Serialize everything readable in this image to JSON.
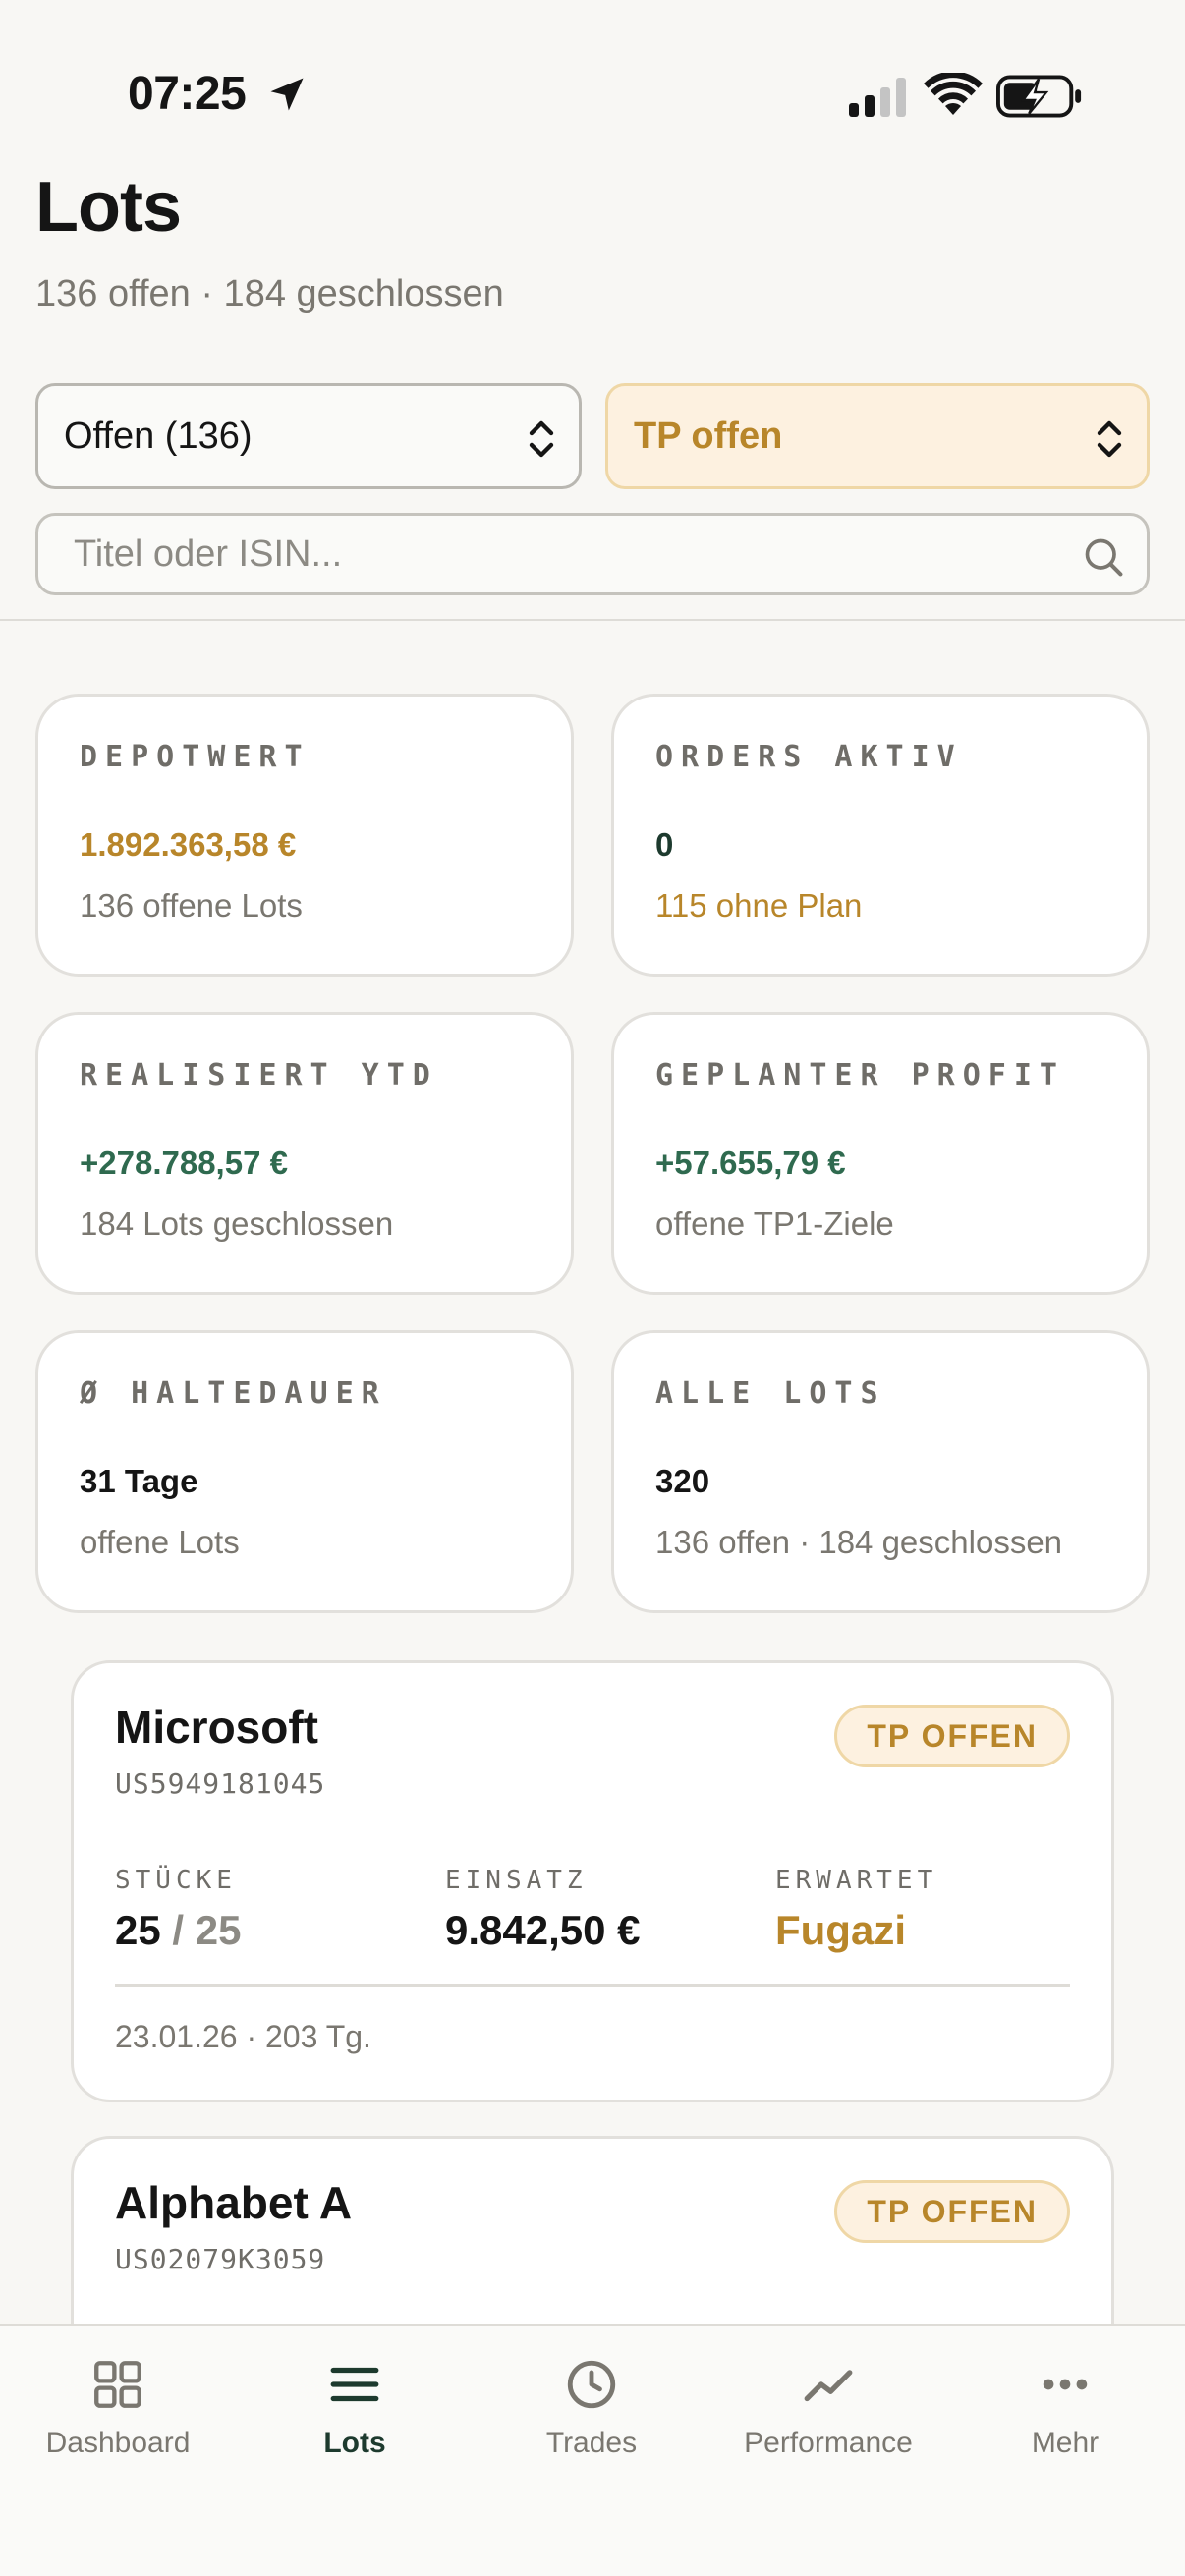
{
  "status_bar": {
    "time": "07:25"
  },
  "header": {
    "title": "Lots",
    "subtitle": "136 offen · 184 geschlossen"
  },
  "filters": {
    "status_select": "Offen (136)",
    "tp_select": "TP offen",
    "search_placeholder": "Titel oder ISIN..."
  },
  "stats": [
    {
      "label": "DEPOTWERT",
      "value": "1.892.363,58 €",
      "sub": "136 offene Lots"
    },
    {
      "label": "ORDERS AKTIV",
      "value": "0",
      "sub": "115 ohne Plan"
    },
    {
      "label": "REALISIERT YTD",
      "value": "+278.788,57 €",
      "sub": "184 Lots geschlossen"
    },
    {
      "label": "GEPLANTER PROFIT",
      "value": "+57.655,79 €",
      "sub": "offene TP1-Ziele"
    },
    {
      "label": "Ø HALTEDAUER",
      "value": "31 Tage",
      "sub": "offene Lots"
    },
    {
      "label": "ALLE LOTS",
      "value": "320",
      "sub": "136 offen · 184 geschlossen"
    }
  ],
  "lots": [
    {
      "name": "Microsoft",
      "isin": "US5949181045",
      "badge": "TP OFFEN",
      "pieces_label": "STÜCKE",
      "pieces": "25",
      "pieces_sep": "/",
      "pieces_total": "25",
      "stake_label": "EINSATZ",
      "stake": "9.842,50 €",
      "expected_label": "ERWARTET",
      "expected": "Fugazi",
      "footer": "23.01.26 · 203 Tg."
    },
    {
      "name": "Alphabet A",
      "isin": "US02079K3059",
      "badge": "TP OFFEN"
    }
  ],
  "tabs": [
    {
      "label": "Dashboard",
      "icon": "grid-icon"
    },
    {
      "label": "Lots",
      "icon": "list-icon",
      "active": true
    },
    {
      "label": "Trades",
      "icon": "clock-icon"
    },
    {
      "label": "Performance",
      "icon": "trend-icon"
    },
    {
      "label": "Mehr",
      "icon": "more-icon"
    }
  ],
  "colors": {
    "accent_gold": "#b8862a",
    "accent_green": "#2f6a4f",
    "background": "#f8f7f4"
  }
}
